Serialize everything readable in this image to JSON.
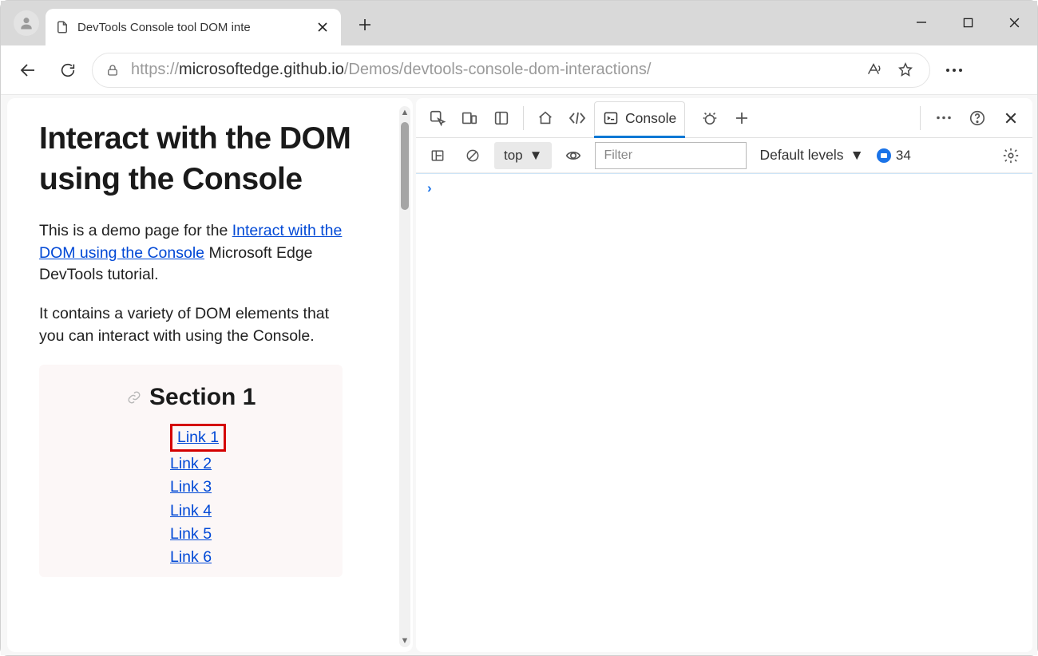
{
  "window": {
    "tab_title": "DevTools Console tool DOM inte"
  },
  "toolbar": {
    "url_prefix": "https://",
    "url_host": "microsoftedge.github.io",
    "url_path": "/Demos/devtools-console-dom-interactions/"
  },
  "page": {
    "title": "Interact with the DOM using the Console",
    "para1_pre": "This is a demo page for the ",
    "para1_link": "Interact with the DOM using the Console",
    "para1_post": " Microsoft Edge DevTools tutorial.",
    "para2": "It contains a variety of DOM elements that you can interact with using the Console.",
    "section_title": "Section 1",
    "links": [
      "Link 1",
      "Link 2",
      "Link 3",
      "Link 4",
      "Link 5",
      "Link 6"
    ]
  },
  "devtools": {
    "tab_console": "Console",
    "context": "top",
    "filter_placeholder": "Filter",
    "levels_label": "Default levels",
    "issue_count": "34",
    "prompt": "›"
  }
}
